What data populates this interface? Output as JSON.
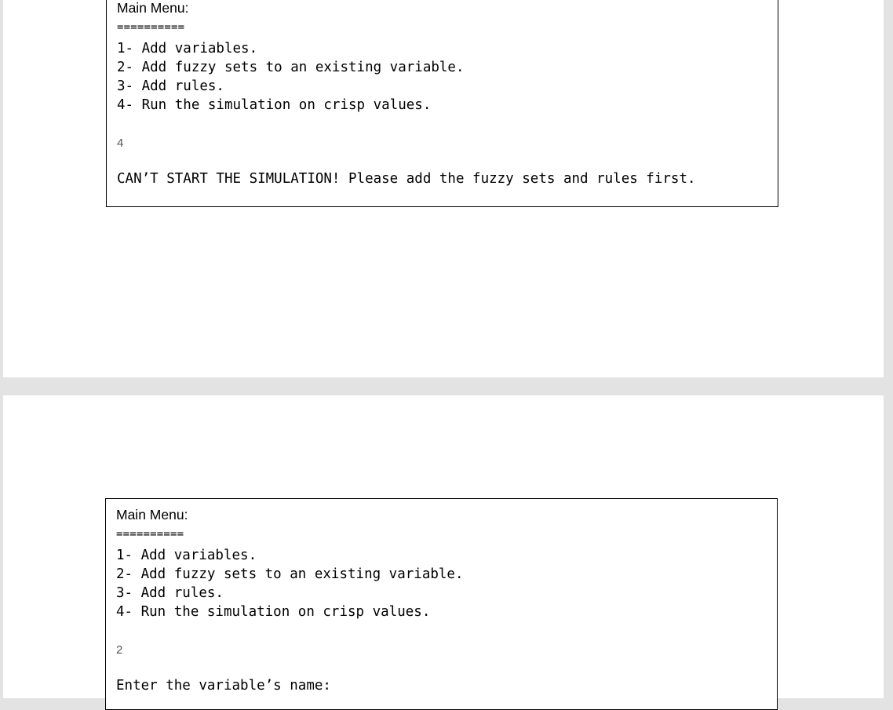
{
  "pages": [
    {
      "menu_title": "Main Menu:",
      "separator": "==========",
      "menu_items": [
        "1- Add variables.",
        "2- Add fuzzy sets to an existing variable.",
        "3- Add rules.",
        "4- Run the simulation on crisp values."
      ],
      "user_input": "4",
      "output": "CAN’T START THE SIMULATION! Please add the fuzzy sets and rules first."
    },
    {
      "menu_title": "Main Menu:",
      "separator": "==========",
      "menu_items": [
        "1- Add variables.",
        "2- Add fuzzy sets to an existing variable.",
        "3- Add rules.",
        "4- Run the simulation on crisp values."
      ],
      "user_input": "2",
      "output": "Enter the variable’s name:"
    }
  ]
}
